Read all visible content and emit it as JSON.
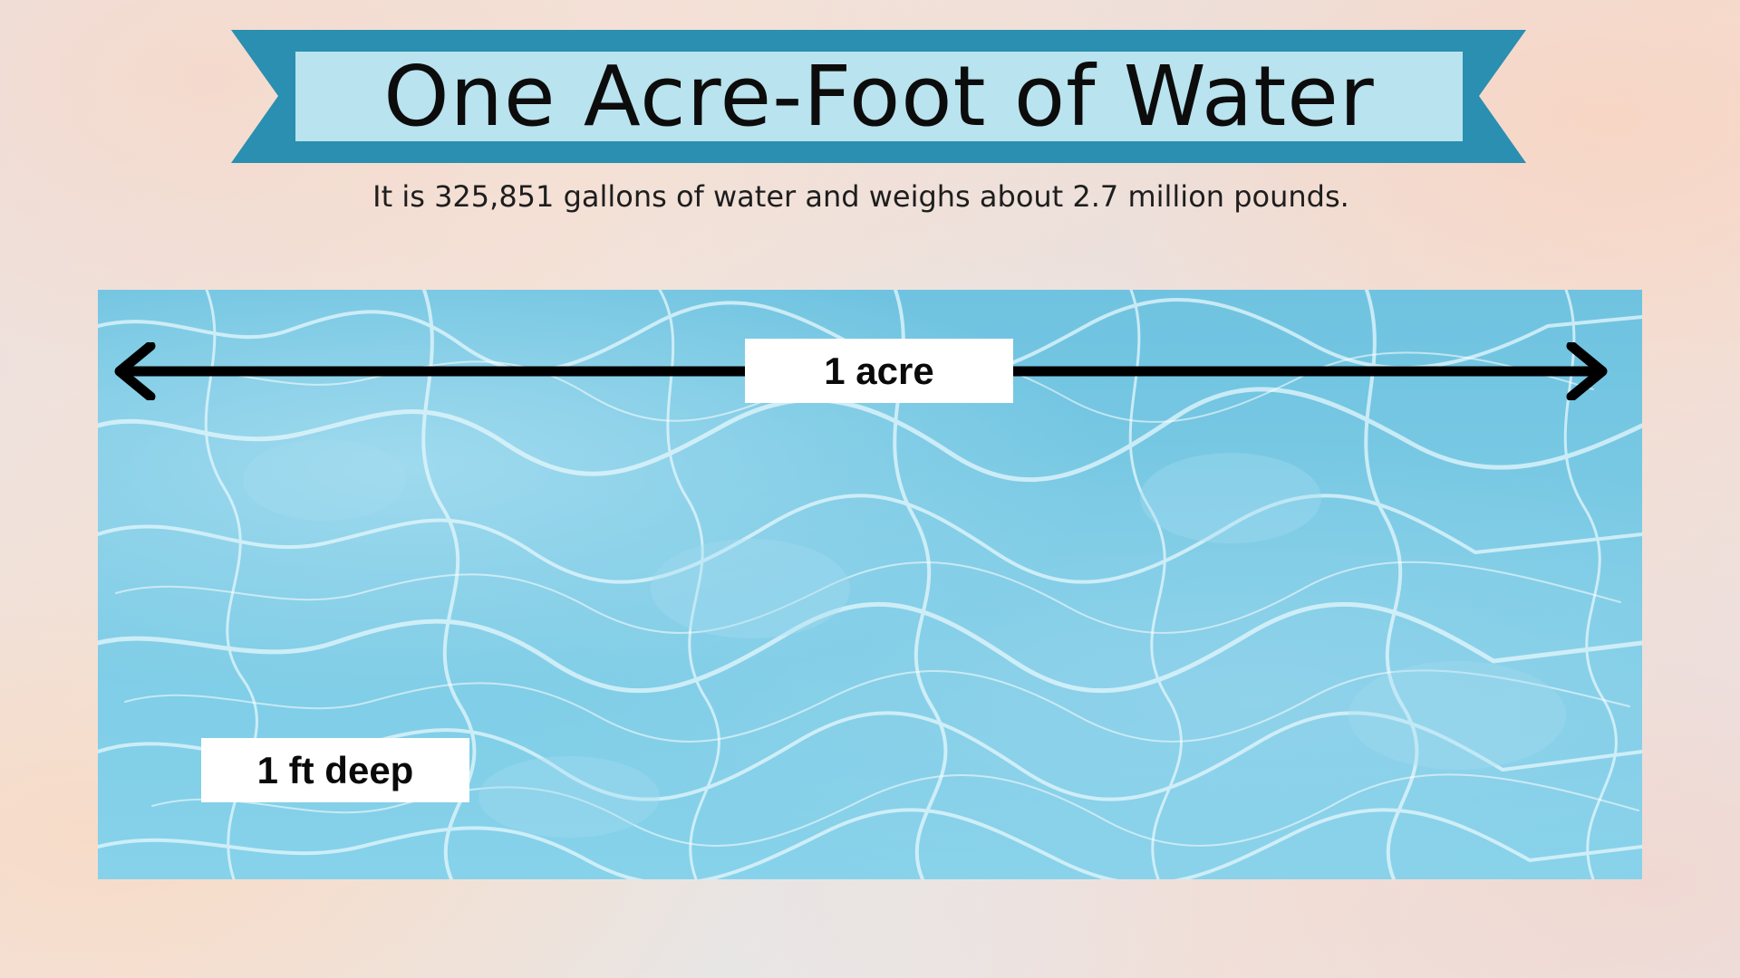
{
  "title": "One Acre-Foot of Water",
  "subtitle": "It is 325,851 gallons of water and weighs about 2.7 million pounds.",
  "labels": {
    "width": "1 acre",
    "depth": "1 ft deep"
  },
  "colors": {
    "ribbon": "#2a8fb0",
    "title_box": "#b9e3ee",
    "water": "#7ccbe5",
    "arrow": "#000000"
  }
}
